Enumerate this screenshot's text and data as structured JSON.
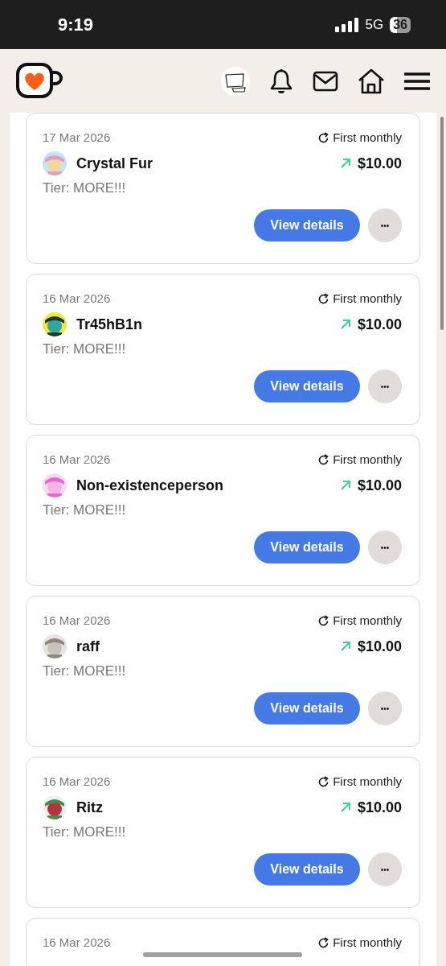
{
  "status_bar": {
    "time": "9:19",
    "network": "5G",
    "battery": "36"
  },
  "cards": [
    {
      "date": "17 Mar 2026",
      "type": "First monthly",
      "name": "Crystal Fur",
      "amount": "$10.00",
      "tier": "Tier: MORE!!!",
      "button": "View details",
      "more": "•••"
    },
    {
      "date": "16 Mar 2026",
      "type": "First monthly",
      "name": "Tr45hB1n",
      "amount": "$10.00",
      "tier": "Tier: MORE!!!",
      "button": "View details",
      "more": "•••"
    },
    {
      "date": "16 Mar 2026",
      "type": "First monthly",
      "name": "Non-existenceperson",
      "amount": "$10.00",
      "tier": "Tier: MORE!!!",
      "button": "View details",
      "more": "•••"
    },
    {
      "date": "16 Mar 2026",
      "type": "First monthly",
      "name": "raff",
      "amount": "$10.00",
      "tier": "Tier: MORE!!!",
      "button": "View details",
      "more": "•••"
    },
    {
      "date": "16 Mar 2026",
      "type": "First monthly",
      "name": "Ritz",
      "amount": "$10.00",
      "tier": "Tier: MORE!!!",
      "button": "View details",
      "more": "•••"
    },
    {
      "date": "16 Mar 2026",
      "type": "First monthly"
    }
  ]
}
